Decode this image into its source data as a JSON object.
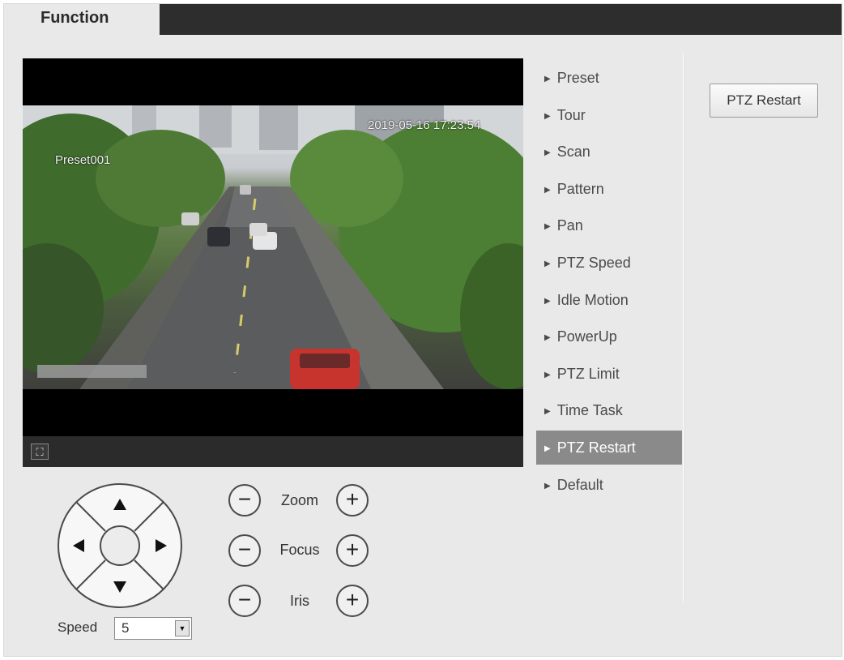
{
  "tabs": {
    "active": "Function"
  },
  "video": {
    "timestamp": "2019-05-16 17:23:54",
    "preset_label": "Preset001",
    "fullscreen_icon": "fullscreen-icon"
  },
  "menu": {
    "items": [
      {
        "label": "Preset"
      },
      {
        "label": "Tour"
      },
      {
        "label": "Scan"
      },
      {
        "label": "Pattern"
      },
      {
        "label": "Pan"
      },
      {
        "label": "PTZ Speed"
      },
      {
        "label": "Idle Motion"
      },
      {
        "label": "PowerUp"
      },
      {
        "label": "PTZ Limit"
      },
      {
        "label": "Time Task"
      },
      {
        "label": "PTZ Restart"
      },
      {
        "label": "Default"
      }
    ],
    "selected": "PTZ Restart"
  },
  "panel": {
    "button_label": "PTZ Restart"
  },
  "ptz": {
    "speed_label": "Speed",
    "speed_value": "5",
    "zoom_label": "Zoom",
    "focus_label": "Focus",
    "iris_label": "Iris",
    "minus_symbol": "−",
    "plus_symbol": "+"
  },
  "colors": {
    "accent": "#8a8a8a",
    "tabbar": "#2d2d2d",
    "panel": "#e9e9e9"
  }
}
